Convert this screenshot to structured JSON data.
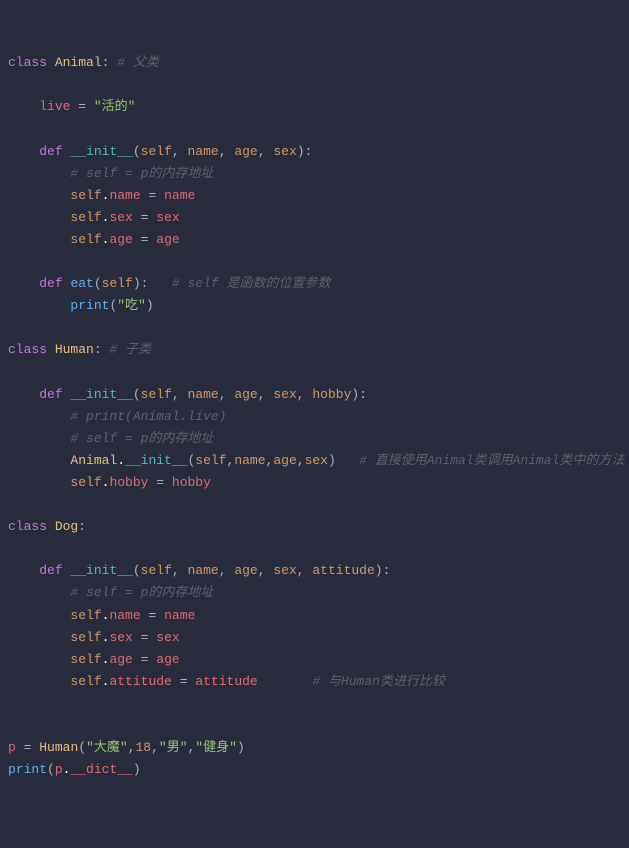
{
  "code": {
    "class1": {
      "kw": "class",
      "name": "Animal",
      "cmt": "# 父类"
    },
    "live": {
      "ident": "live",
      "op": "=",
      "str": "\"活的\""
    },
    "def_init": {
      "kw": "def",
      "fn": "__init__",
      "params": [
        "self",
        "name",
        "age",
        "sex"
      ]
    },
    "cmt_self_p": "# self = p的内存地址",
    "assign_name": {
      "lhs_self": "self",
      "lhs_attr": "name",
      "op": "=",
      "rhs": "name"
    },
    "assign_sex": {
      "lhs_self": "self",
      "lhs_attr": "sex",
      "op": "=",
      "rhs": "sex"
    },
    "assign_age": {
      "lhs_self": "self",
      "lhs_attr": "age",
      "op": "=",
      "rhs": "age"
    },
    "def_eat": {
      "kw": "def",
      "fn": "eat",
      "params": [
        "self"
      ],
      "cmt": "# self 是函数的位置参数"
    },
    "print_eat": {
      "fn": "print",
      "str": "\"吃\""
    },
    "class2": {
      "kw": "class",
      "name": "Human",
      "cmt": "# 子类"
    },
    "def_init2": {
      "kw": "def",
      "fn": "__init__",
      "params": [
        "self",
        "name",
        "age",
        "sex",
        "hobby"
      ]
    },
    "cmt_print_live": "# print(Animal.live)",
    "cmt_self_p2": "# self = p的内存地址",
    "animal_call": {
      "cls": "Animal",
      "fn": "__init__",
      "args": [
        "self",
        "name",
        "age",
        "sex"
      ],
      "cmt": "# 直接使用Animal类调用Animal类中的方法"
    },
    "assign_hobby": {
      "lhs_self": "self",
      "lhs_attr": "hobby",
      "op": "=",
      "rhs": "hobby"
    },
    "class3": {
      "kw": "class",
      "name": "Dog"
    },
    "def_init3": {
      "kw": "def",
      "fn": "__init__",
      "params": [
        "self",
        "name",
        "age",
        "sex",
        "attitude"
      ]
    },
    "cmt_self_p3": "# self = p的内存地址",
    "assign_name3": {
      "lhs_self": "self",
      "lhs_attr": "name",
      "op": "=",
      "rhs": "name"
    },
    "assign_sex3": {
      "lhs_self": "self",
      "lhs_attr": "sex",
      "op": "=",
      "rhs": "sex"
    },
    "assign_age3": {
      "lhs_self": "self",
      "lhs_attr": "age",
      "op": "=",
      "rhs": "age"
    },
    "assign_attitude": {
      "lhs_self": "self",
      "lhs_attr": "attitude",
      "op": "=",
      "rhs": "attitude",
      "cmt": "# 与Human类进行比较"
    },
    "inst": {
      "var": "p",
      "op": "=",
      "cls": "Human",
      "args_str": [
        "\"大魔\"",
        "\"男\"",
        "\"健身\""
      ],
      "args_num": [
        "18"
      ]
    },
    "print_dict": {
      "fn": "print",
      "var": "p",
      "attr": "__dict__"
    }
  }
}
